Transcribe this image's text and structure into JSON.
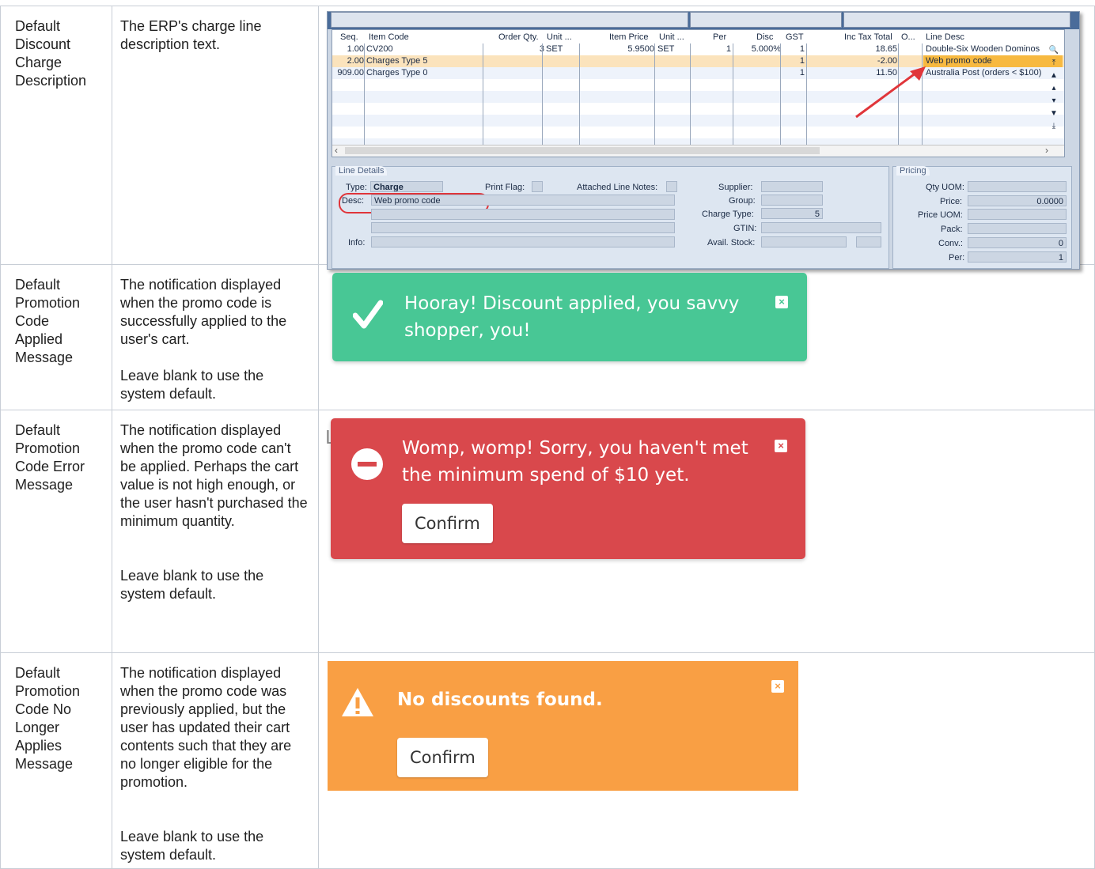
{
  "rows": [
    {
      "name_lines": [
        "Default",
        "Discount",
        "Charge",
        "Description"
      ],
      "desc_paragraphs": [
        "The ERP's charge line description text."
      ]
    },
    {
      "name_lines": [
        "Default",
        "Promotion",
        "Code",
        "Applied",
        "Message"
      ],
      "desc_paragraphs": [
        "The notification displayed when the promo code is successfully applied to the user's cart.",
        "Leave blank to use the system default."
      ]
    },
    {
      "name_lines": [
        "Default",
        "Promotion",
        "Code Error",
        "Message"
      ],
      "desc_paragraphs": [
        "The notification displayed when the promo code can't be applied. Perhaps the cart value is not high enough, or the user hasn't purchased the minimum quantity.",
        "Leave blank to use the system default."
      ]
    },
    {
      "name_lines": [
        "Default",
        "Promotion",
        "Code No",
        "Longer",
        "Applies",
        "Message"
      ],
      "desc_paragraphs": [
        "The notification displayed when the promo code was previously applied, but the user has updated their cart contents such that they are no longer eligible for the promotion.",
        "Leave blank to use the system default."
      ]
    }
  ],
  "erp": {
    "headers": [
      "Seq.",
      "Item Code",
      "Order Qty.",
      "Unit ...",
      "Item Price",
      "Unit ...",
      "Per",
      "Disc",
      "GST",
      "Inc Tax Total",
      "O...",
      "Line Desc"
    ],
    "lines": [
      {
        "seq": "1.00",
        "item": "CV200",
        "qty": "3",
        "unit": "SET",
        "price": "5.9500",
        "unit2": "SET",
        "per": "1",
        "disc": "5.000%",
        "gst": "1",
        "total": "18.65",
        "desc": "Double-Six Wooden Dominos"
      },
      {
        "seq": "2.00",
        "item": "Charges Type 5",
        "qty": "",
        "unit": "",
        "price": "",
        "unit2": "",
        "per": "",
        "disc": "",
        "gst": "1",
        "total": "-2.00",
        "desc": "Web promo code"
      },
      {
        "seq": "909.00",
        "item": "Charges Type 0",
        "qty": "",
        "unit": "",
        "price": "",
        "unit2": "",
        "per": "",
        "disc": "",
        "gst": "1",
        "total": "11.50",
        "desc": "Australia Post (orders < $100)"
      }
    ],
    "line_details": {
      "title": "Line Details",
      "type_label": "Type:",
      "type_value": "Charge",
      "print_flag_label": "Print Flag:",
      "attached_notes_label": "Attached Line Notes:",
      "desc_label": "Desc:",
      "desc_value": "Web promo code",
      "info_label": "Info:",
      "supplier_label": "Supplier:",
      "group_label": "Group:",
      "charge_type_label": "Charge Type:",
      "charge_type_value": "5",
      "gtin_label": "GTIN:",
      "avail_stock_label": "Avail. Stock:"
    },
    "pricing": {
      "title": "Pricing",
      "qty_uom_label": "Qty UOM:",
      "price_label": "Price:",
      "price_value": "0.0000",
      "price_uom_label": "Price UOM:",
      "pack_label": "Pack:",
      "conv_label": "Conv.:",
      "conv_value": "0",
      "per_label": "Per:",
      "per_value": "1"
    }
  },
  "notifications": {
    "success": {
      "line1": "Hooray! Discount applied, you savvy",
      "line2": "shopper, you!",
      "close": "×",
      "color": "#48c795"
    },
    "error": {
      "line1": "Womp, womp! Sorry, you haven't met",
      "line2": "the minimum spend of $10 yet.",
      "button": "Confirm",
      "close": "×",
      "background_text": "Lo",
      "color": "#d9484c"
    },
    "warning": {
      "line1": "No discounts found.",
      "button": "Confirm",
      "close": "×",
      "color": "#f99f44"
    }
  }
}
